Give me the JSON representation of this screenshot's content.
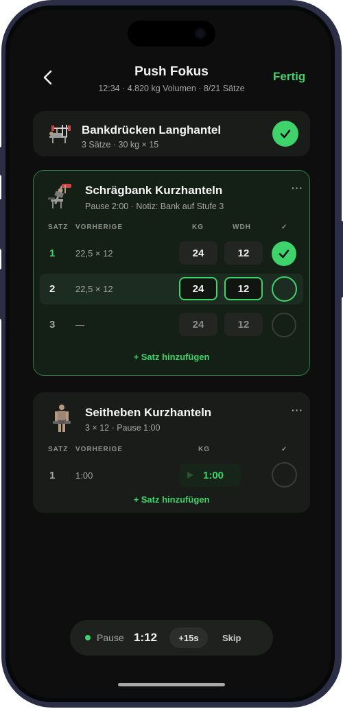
{
  "header": {
    "title": "Push Fokus",
    "subtitle": "12:34 · 4.820 kg Volumen · 8/21 Sätze",
    "done_label": "Fertig"
  },
  "exercises": [
    {
      "title": "Bankdrücken Langhantel",
      "subtitle": "3 Sätze · 30 kg × 15",
      "completed": true
    },
    {
      "title": "Schrägbank Kurzhanteln",
      "subtitle": "Pause 2:00 · Notiz: Bank auf Stufe 3",
      "more_label": "···",
      "columns": {
        "set": "SATZ",
        "previous": "VORHERIGE",
        "kg": "KG",
        "reps": "WDH",
        "done": "✓"
      },
      "sets": [
        {
          "num": "1",
          "previous": "22,5 × 12",
          "kg": "24",
          "reps": "12",
          "state": "done"
        },
        {
          "num": "2",
          "previous": "22,5 × 12",
          "kg": "24",
          "reps": "12",
          "state": "active"
        },
        {
          "num": "3",
          "previous": "—",
          "kg": "24",
          "reps": "12",
          "state": "pending"
        }
      ],
      "add_set_label": "+ Satz hinzufügen"
    },
    {
      "title": "Seitheben Kurzhanteln",
      "subtitle": "3 × 12 · Pause 1:00",
      "more_label": "···",
      "columns": {
        "set": "SATZ",
        "previous": "VORHERIGE",
        "kg": "KG",
        "done": "✓"
      },
      "sets": [
        {
          "num": "1",
          "previous": "1:00",
          "timer": "1:00",
          "state": "pending"
        }
      ],
      "add_set_label": "+ Satz hinzufügen"
    }
  ],
  "rest_timer": {
    "label": "Pause",
    "time": "1:12",
    "add_label": "+15s",
    "skip_label": "Skip"
  },
  "colors": {
    "accent": "#3ed36b",
    "background": "#0d0e0d",
    "card": "#1a1c1a"
  }
}
